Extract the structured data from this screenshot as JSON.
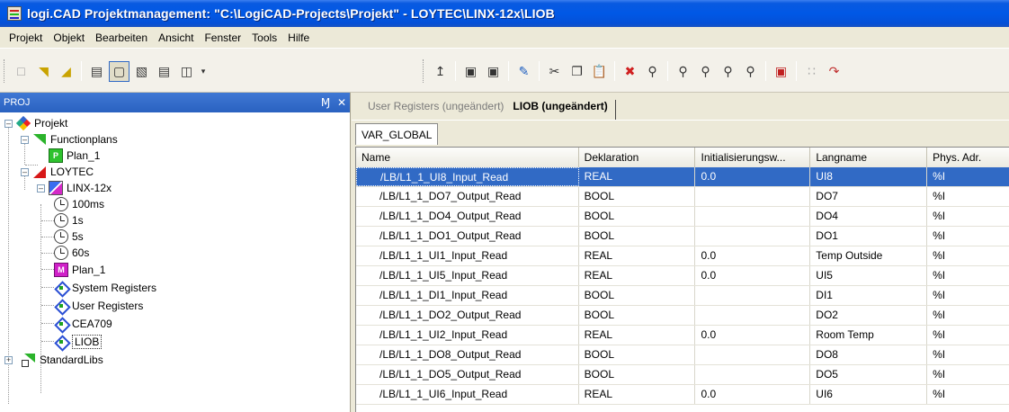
{
  "window": {
    "title": "logi.CAD Projektmanagement: \"C:\\LogiCAD-Projects\\Projekt\" - LOYTEC\\LINX-12x\\LIOB"
  },
  "menu": [
    {
      "label": "Projekt"
    },
    {
      "label": "Objekt"
    },
    {
      "label": "Bearbeiten"
    },
    {
      "label": "Ansicht"
    },
    {
      "label": "Fenster"
    },
    {
      "label": "Tools"
    },
    {
      "label": "Hilfe"
    }
  ],
  "panel": {
    "title": "PROJ",
    "pin_glyph": "Ɱ",
    "close_glyph": "✕"
  },
  "tree": [
    {
      "label": "Projekt",
      "icon": "projekt-icon"
    },
    {
      "label": "Functionplans",
      "icon": "green-folder-icon"
    },
    {
      "label": "Plan_1",
      "icon": "plan-p-icon",
      "badge": "P"
    },
    {
      "label": "LOYTEC",
      "icon": "red-folder-icon"
    },
    {
      "label": "LINX-12x",
      "icon": "device-icon"
    },
    {
      "label": "100ms",
      "icon": "timer-icon"
    },
    {
      "label": "1s",
      "icon": "timer-icon"
    },
    {
      "label": "5s",
      "icon": "timer-icon"
    },
    {
      "label": "60s",
      "icon": "timer-icon"
    },
    {
      "label": "Plan_1",
      "icon": "plan-m-icon",
      "badge": "M"
    },
    {
      "label": "System Registers",
      "icon": "register-icon"
    },
    {
      "label": "User Registers",
      "icon": "register-icon"
    },
    {
      "label": "CEA709",
      "icon": "register-icon"
    },
    {
      "label": "LIOB",
      "icon": "register-icon"
    },
    {
      "label": "StandardLibs",
      "icon": "stdlib-icon"
    }
  ],
  "doc_tabs": [
    {
      "label": "User Registers (ungeändert)"
    },
    {
      "label": "LIOB (ungeändert)"
    }
  ],
  "inner_tab": "VAR_GLOBAL",
  "table": {
    "columns": [
      "Name",
      "Deklaration",
      "Initialisierungsw...",
      "Langname",
      "Phys. Adr."
    ],
    "rows": [
      [
        "/LB/L1_1_UI8_Input_Read",
        "REAL",
        "0.0",
        "UI8",
        "%I"
      ],
      [
        "/LB/L1_1_DO7_Output_Read",
        "BOOL",
        "",
        "DO7",
        "%I"
      ],
      [
        "/LB/L1_1_DO4_Output_Read",
        "BOOL",
        "",
        "DO4",
        "%I"
      ],
      [
        "/LB/L1_1_DO1_Output_Read",
        "BOOL",
        "",
        "DO1",
        "%I"
      ],
      [
        "/LB/L1_1_UI1_Input_Read",
        "REAL",
        "0.0",
        "Temp Outside",
        "%I"
      ],
      [
        "/LB/L1_1_UI5_Input_Read",
        "REAL",
        "0.0",
        "UI5",
        "%I"
      ],
      [
        "/LB/L1_1_DI1_Input_Read",
        "BOOL",
        "",
        "DI1",
        "%I"
      ],
      [
        "/LB/L1_1_DO2_Output_Read",
        "BOOL",
        "",
        "DO2",
        "%I"
      ],
      [
        "/LB/L1_1_UI2_Input_Read",
        "REAL",
        "0.0",
        "Room Temp",
        "%I"
      ],
      [
        "/LB/L1_1_DO8_Output_Read",
        "BOOL",
        "",
        "DO8",
        "%I"
      ],
      [
        "/LB/L1_1_DO5_Output_Read",
        "BOOL",
        "",
        "DO5",
        "%I"
      ],
      [
        "/LB/L1_1_UI6_Input_Read",
        "REAL",
        "0.0",
        "UI6",
        "%I"
      ]
    ]
  },
  "colors": {
    "titlebar": "#0058e6",
    "selection": "#316ac5",
    "panel_head": "#3169c6"
  }
}
